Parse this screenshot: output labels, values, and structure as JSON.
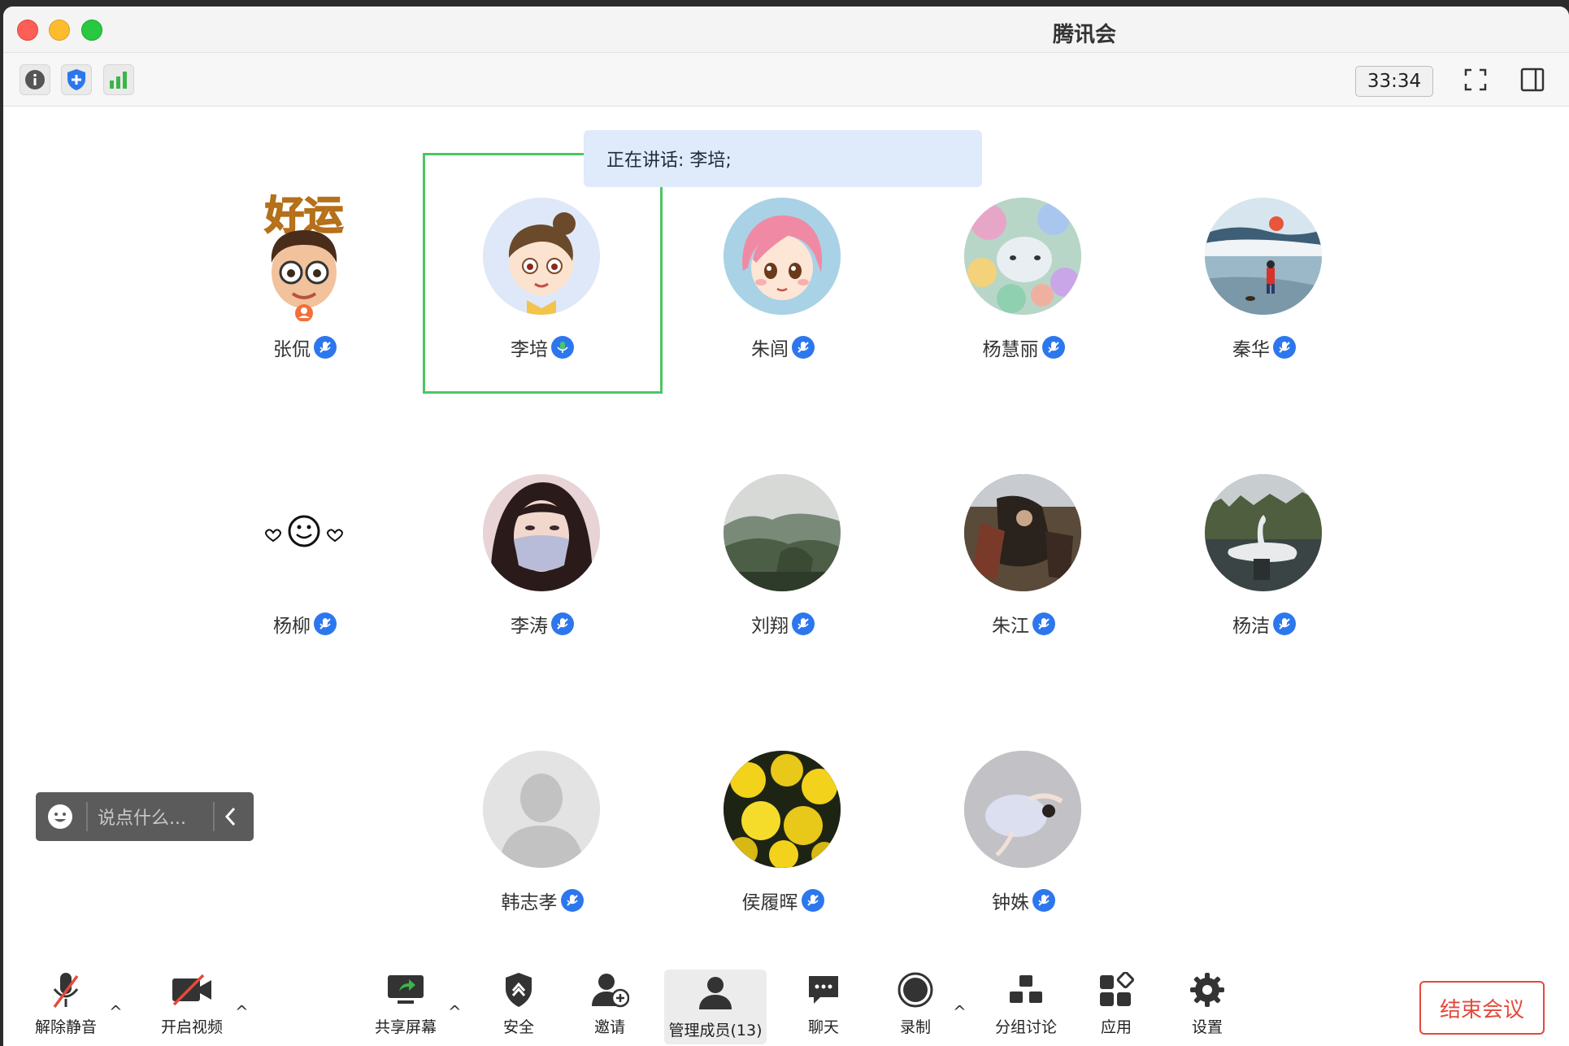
{
  "window": {
    "title": "腾讯会议"
  },
  "toolbar": {
    "timer": "33:34"
  },
  "speaking": {
    "text": "正在讲话: 李培;"
  },
  "participants": [
    {
      "name": "张侃",
      "avatar": "memoji-good-luck"
    },
    {
      "name": "李培",
      "avatar": "cartoon-girl-bun",
      "speaking": true
    },
    {
      "name": "朱闾",
      "avatar": "cartoon-pink-hair-girl"
    },
    {
      "name": "杨慧丽",
      "avatar": "floral-sheep-painting"
    },
    {
      "name": "秦华",
      "avatar": "winter-landscape-illustration"
    },
    {
      "name": "杨柳",
      "avatar": "smiley-hearts-emoji"
    },
    {
      "name": "李涛",
      "avatar": "masked-woman-photo"
    },
    {
      "name": "刘翔",
      "avatar": "mountain-landscape-photo"
    },
    {
      "name": "朱江",
      "avatar": "dark-painting-photo"
    },
    {
      "name": "杨洁",
      "avatar": "swan-lake-photo"
    },
    {
      "name": "韩志孝",
      "avatar": "default-person"
    },
    {
      "name": "侯履晖",
      "avatar": "yellow-flowers-photo"
    },
    {
      "name": "钟姝",
      "avatar": "ballerina-photo"
    }
  ],
  "chat": {
    "placeholder": "说点什么..."
  },
  "bottombar": {
    "unmute": "解除静音",
    "video": "开启视频",
    "share": "共享屏幕",
    "security": "安全",
    "invite": "邀请",
    "members": "管理成员(13)",
    "chat": "聊天",
    "record": "录制",
    "breakout": "分组讨论",
    "apps": "应用",
    "settings": "设置",
    "end": "结束会议"
  },
  "colors": {
    "accent": "#2d77ee",
    "speaking_border": "#4cc663",
    "end": "#e34a3b"
  }
}
